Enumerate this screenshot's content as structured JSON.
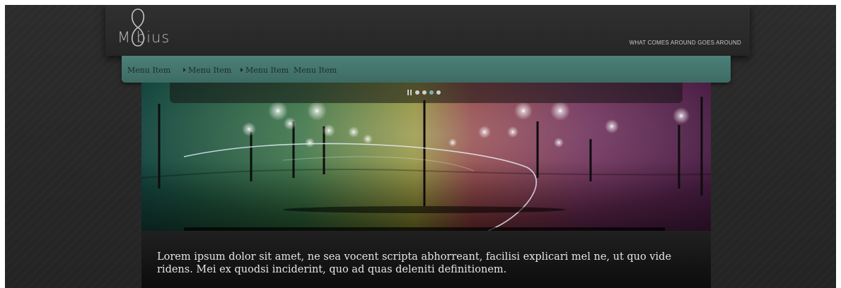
{
  "header": {
    "logo_text": "M bius",
    "tagline": "WHAT COMES AROUND GOES AROUND"
  },
  "menu": {
    "items": [
      {
        "label": "Menu Item",
        "has_arrow": false
      },
      {
        "label": "Menu Item",
        "has_arrow": true
      },
      {
        "label": "Menu Item",
        "has_arrow": true
      },
      {
        "label": "Menu Item",
        "has_arrow": false
      }
    ]
  },
  "slider": {
    "dot_count": 4,
    "active_dot": 3
  },
  "caption": {
    "text": "Lorem ipsum dolor sit amet, ne sea vocent scripta abhorreant, facilisi explicari mel ne, ut quo vide ridens. Mei ex quodsi inciderint, quo ad quas deleniti definitionem."
  },
  "colors": {
    "page_background": "#282828",
    "menu_bar": "#467870",
    "active_dot": "#6fb7ad"
  }
}
